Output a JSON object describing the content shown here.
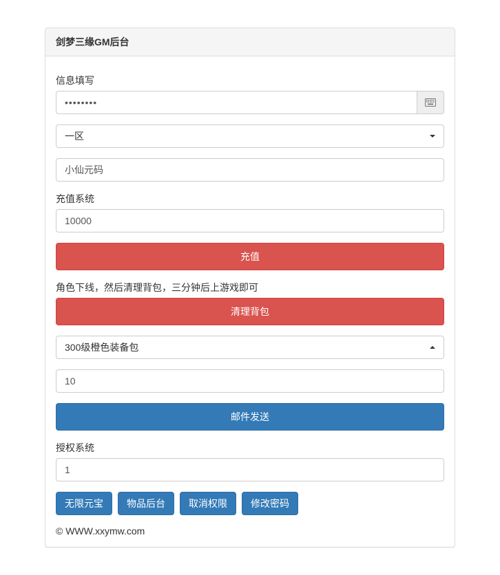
{
  "panel": {
    "title": "剑梦三缘GM后台"
  },
  "info": {
    "label": "信息填写",
    "password_value": "••••••••",
    "zone_selected": "一区",
    "code_value": "小仙元码"
  },
  "recharge": {
    "label": "充值系统",
    "amount_value": "10000",
    "button": "充值"
  },
  "clear": {
    "note": "角色下线，然后清理背包，三分钟后上游戏即可",
    "button": "清理背包"
  },
  "mail": {
    "item_selected": "300级橙色装备包",
    "qty_value": "10",
    "button": "邮件发送"
  },
  "auth": {
    "label": "授权系统",
    "value": "1",
    "buttons": {
      "unlimited_gold": "无限元宝",
      "item_backend": "物品后台",
      "revoke": "取消权限",
      "change_pw": "修改密码"
    }
  },
  "footer": "© WWW.xxymw.com"
}
